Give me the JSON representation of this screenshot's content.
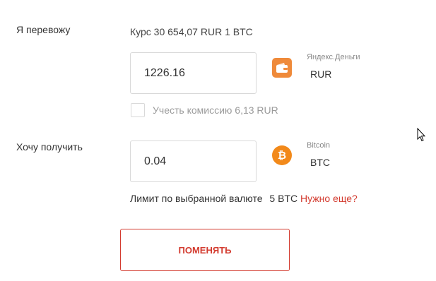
{
  "send": {
    "label": "Я перевожу",
    "rate_text": "Курс 30 654,07 RUR 1 BTC",
    "amount": "1226.16",
    "currency_name": "Яндекс.Деньги",
    "currency_code": "RUR",
    "icon": "wallet-icon",
    "commission_label": "Учесть комиссию 6,13 RUR",
    "commission_checked": false
  },
  "receive": {
    "label": "Хочу получить",
    "amount": "0.04",
    "currency_name": "Bitcoin",
    "currency_code": "BTC",
    "icon": "bitcoin-icon",
    "icon_glyph": "₿"
  },
  "limit": {
    "text": "Лимит по выбранной валюте",
    "value": "5 BTC",
    "more_link": "Нужно еще?"
  },
  "submit_label": "ПОМЕНЯТЬ",
  "colors": {
    "accent": "#d33b2f",
    "wallet": "#ef8a3a",
    "bitcoin": "#f2891a"
  }
}
